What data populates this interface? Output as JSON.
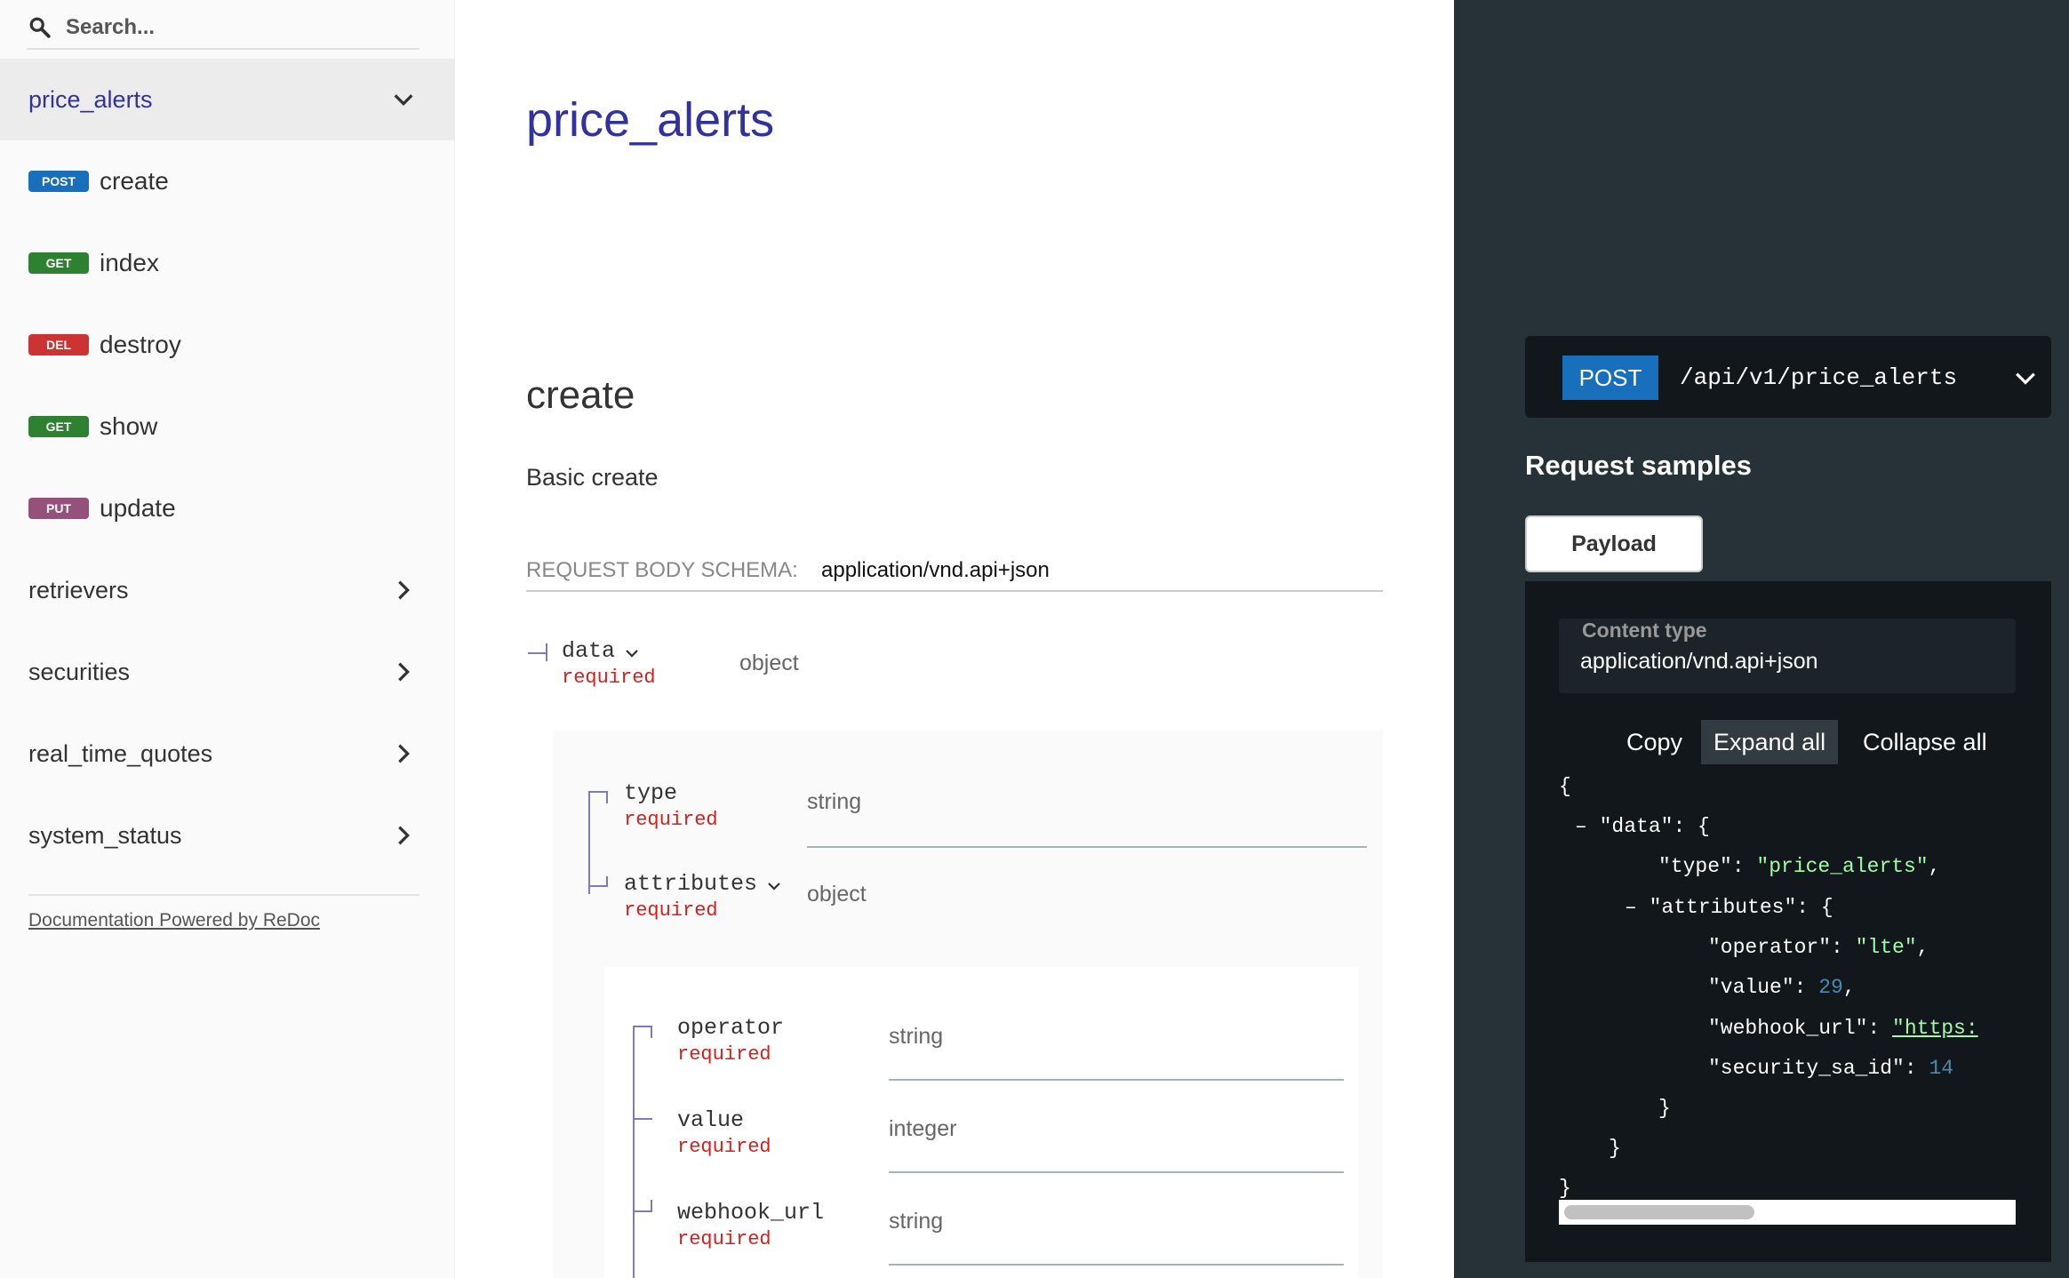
{
  "search": {
    "placeholder": "Search..."
  },
  "sidebar": {
    "active_group": "price_alerts",
    "operations": [
      {
        "method": "POST",
        "label": "create",
        "color": "#186fbb"
      },
      {
        "method": "GET",
        "label": "index",
        "color": "#2f8132"
      },
      {
        "method": "DEL",
        "label": "destroy",
        "color": "#cc3333"
      },
      {
        "method": "GET",
        "label": "show",
        "color": "#2f8132"
      },
      {
        "method": "PUT",
        "label": "update",
        "color": "#95507c"
      }
    ],
    "groups": [
      "retrievers",
      "securities",
      "real_time_quotes",
      "system_status"
    ],
    "powered_by": "Documentation Powered by ReDoc"
  },
  "main": {
    "tag_title": "price_alerts",
    "operation_title": "create",
    "operation_description": "Basic create",
    "request_body_label": "REQUEST BODY SCHEMA:",
    "request_body_type": "application/vnd.api+json",
    "params": {
      "data": {
        "name": "data",
        "required": "required",
        "type": "object"
      },
      "type": {
        "name": "type",
        "required": "required",
        "type": "string"
      },
      "attributes": {
        "name": "attributes",
        "required": "required",
        "type": "object"
      },
      "operator": {
        "name": "operator",
        "required": "required",
        "type": "string"
      },
      "value": {
        "name": "value",
        "required": "required",
        "type": "integer"
      },
      "webhook_url": {
        "name": "webhook_url",
        "required": "required",
        "type": "string"
      }
    }
  },
  "right": {
    "endpoint_method": "POST",
    "endpoint_path": "/api/v1/price_alerts",
    "request_samples_title": "Request samples",
    "payload_tab": "Payload",
    "content_type_label": "Content type",
    "content_type_value": "application/vnd.api+json",
    "copy": "Copy",
    "expand_all": "Expand all",
    "collapse_all": "Collapse all",
    "code": {
      "open": "{",
      "collapse_sign": "–",
      "data_key": "\"data\": {",
      "type_key": "\"type\": ",
      "type_val": "\"price_alerts\"",
      "attrs_key": "\"attributes\": {",
      "operator_key": "\"operator\": ",
      "operator_val": "\"lte\"",
      "value_key": "\"value\": ",
      "value_val": "29",
      "webhook_key": "\"webhook_url\": ",
      "webhook_val": "\"https:",
      "security_key": "\"security_sa_id\": ",
      "security_val": "14",
      "close_inner": "}",
      "close_data": "}",
      "close": "}",
      "comma": ","
    }
  }
}
